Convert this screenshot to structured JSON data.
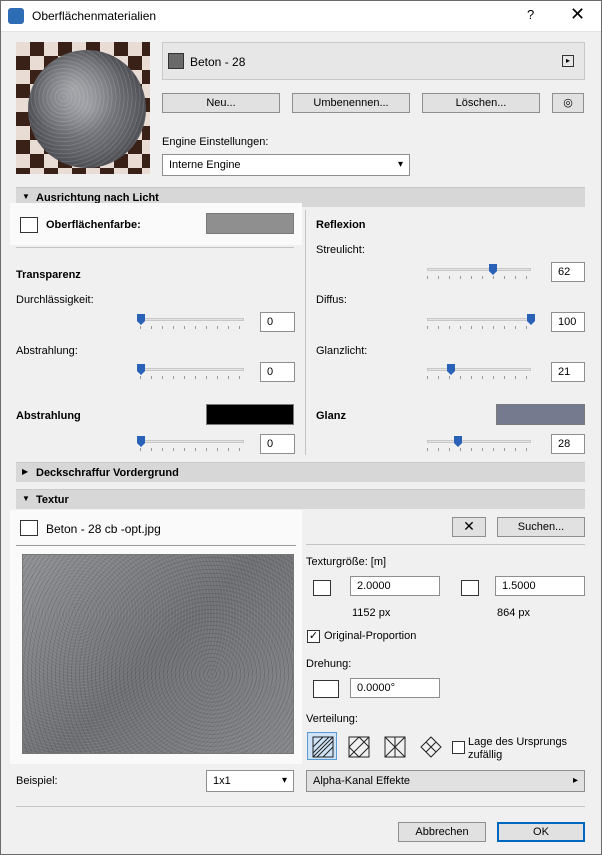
{
  "window": {
    "title": "Oberflächenmaterialien",
    "help": "?",
    "close": "✕"
  },
  "material": {
    "name": "Beton - 28",
    "swatch_color": "#6a6a6a"
  },
  "buttons": {
    "new": "Neu...",
    "rename": "Umbenennen...",
    "delete": "Löschen...",
    "search": "Suchen...",
    "cancel": "Abbrechen",
    "ok": "OK"
  },
  "engine": {
    "label": "Engine Einstellungen:",
    "value": "Interne Engine"
  },
  "sections": {
    "light": "Ausrichtung nach Licht",
    "hatch": "Deckschraffur Vordergrund",
    "texture": "Textur"
  },
  "surface": {
    "label": "Oberflächenfarbe:",
    "color": "#8f8f8f"
  },
  "transparency": {
    "title": "Transparenz",
    "permeability_label": "Durchlässigkeit:",
    "permeability_value": "0",
    "emission_label": "Abstrahlung:",
    "emission_value": "0"
  },
  "emission": {
    "title": "Abstrahlung",
    "color": "#000000",
    "value": "0"
  },
  "reflection": {
    "title": "Reflexion",
    "scatter_label": "Streulicht:",
    "scatter_value": "62",
    "diffuse_label": "Diffus:",
    "diffuse_value": "100",
    "highlight_label": "Glanzlicht:",
    "highlight_value": "21"
  },
  "gloss": {
    "title": "Glanz",
    "color": "#767a8e",
    "value": "28"
  },
  "texture": {
    "file": "Beton - 28 cb -opt.jpg",
    "size_label": "Texturgröße: [m]",
    "width": "2.0000",
    "height": "1.5000",
    "width_px": "1152 px",
    "height_px": "864 px",
    "original_proportion": "Original-Proportion",
    "rotation_label": "Drehung:",
    "rotation_value": "0.0000°",
    "distribution_label": "Verteilung:",
    "origin_random": "Lage des Ursprungs zufällig",
    "sample_label": "Beispiel:",
    "sample_value": "1x1",
    "alpha": "Alpha-Kanal Effekte"
  }
}
